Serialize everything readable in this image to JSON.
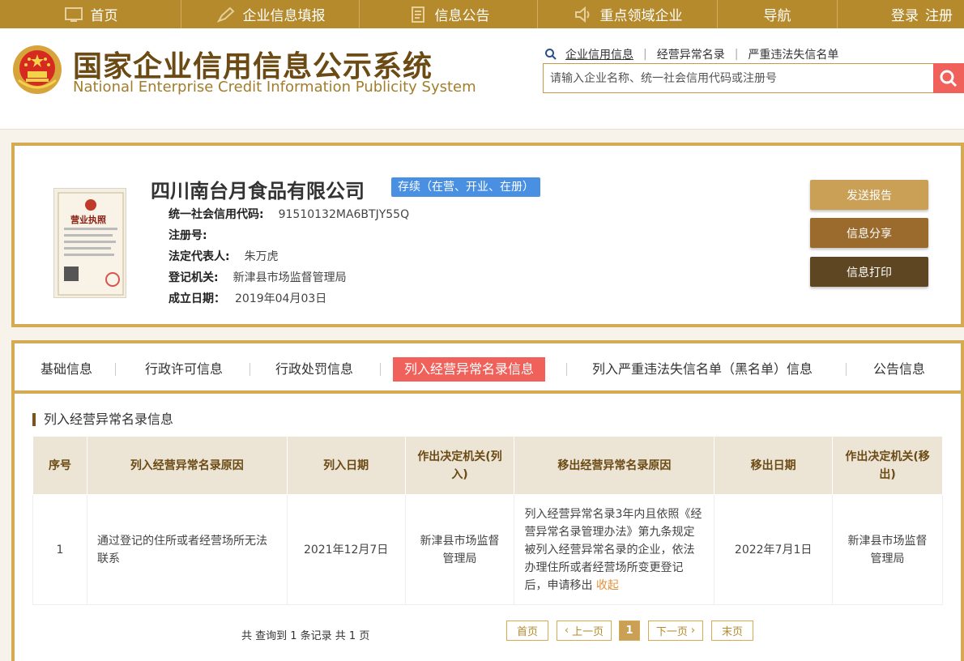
{
  "nav": {
    "items": [
      {
        "label": "首页",
        "icon": "home-icon"
      },
      {
        "label": "企业信息填报",
        "icon": "pen-icon"
      },
      {
        "label": "信息公告",
        "icon": "document-icon"
      },
      {
        "label": "重点领域企业",
        "icon": "speaker-icon"
      },
      {
        "label": "导航",
        "icon": ""
      }
    ],
    "login": "登录",
    "register": "注册"
  },
  "header": {
    "title_cn": "国家企业信用信息公示系统",
    "title_en": "National Enterprise Credit Information Publicity System",
    "quick_links": [
      "企业信用信息",
      "经营异常名录",
      "严重违法失信名单"
    ],
    "search_placeholder": "请输入企业名称、统一社会信用代码或注册号"
  },
  "company": {
    "name": "四川南台月食品有限公司",
    "status": "存续（在营、开业、在册）",
    "fields": [
      {
        "label": "统一社会信用代码:",
        "value": "91510132MA6BTJY55Q"
      },
      {
        "label": "注册号:",
        "value": ""
      },
      {
        "label": "法定代表人:",
        "value": "朱万虎"
      },
      {
        "label": "登记机关:",
        "value": "新津县市场监督管理局"
      },
      {
        "label": "成立日期：",
        "value": "2019年04月03日"
      }
    ],
    "license_label": "营业执照",
    "actions": [
      "发送报告",
      "信息分享",
      "信息打印"
    ]
  },
  "tabs": [
    "基础信息",
    "行政许可信息",
    "行政处罚信息",
    "列入经营异常名录信息",
    "列入严重违法失信名单（黑名单）信息",
    "公告信息"
  ],
  "section_title": "列入经营异常名录信息",
  "table": {
    "headers": [
      "序号",
      "列入经营异常名录原因",
      "列入日期",
      "作出决定机关(列入)",
      "移出经营异常名录原因",
      "移出日期",
      "作出决定机关(移出)"
    ],
    "rows": [
      {
        "no": "1",
        "reason_in": "通过登记的住所或者经营场所无法联系",
        "date_in": "2021年12月7日",
        "authority_in": "新津县市场监督管理局",
        "reason_out": "列入经营异常名录3年内且依照《经营异常名录管理办法》第九条规定被列入经营异常名录的企业，依法办理住所或者经营场所变更登记后，申请移出",
        "collapse": "收起",
        "date_out": "2022年7月1日",
        "authority_out": "新津县市场监督管理局"
      }
    ]
  },
  "pager": {
    "summary": "共 查询到 1 条记录 共 1 页",
    "first": "首页",
    "prev": "上一页",
    "current": "1",
    "next": "下一页",
    "last": "末页"
  },
  "colors": {
    "gold": "#b58a2c",
    "accent": "#f0615b",
    "status_blue": "#4a90e2"
  }
}
